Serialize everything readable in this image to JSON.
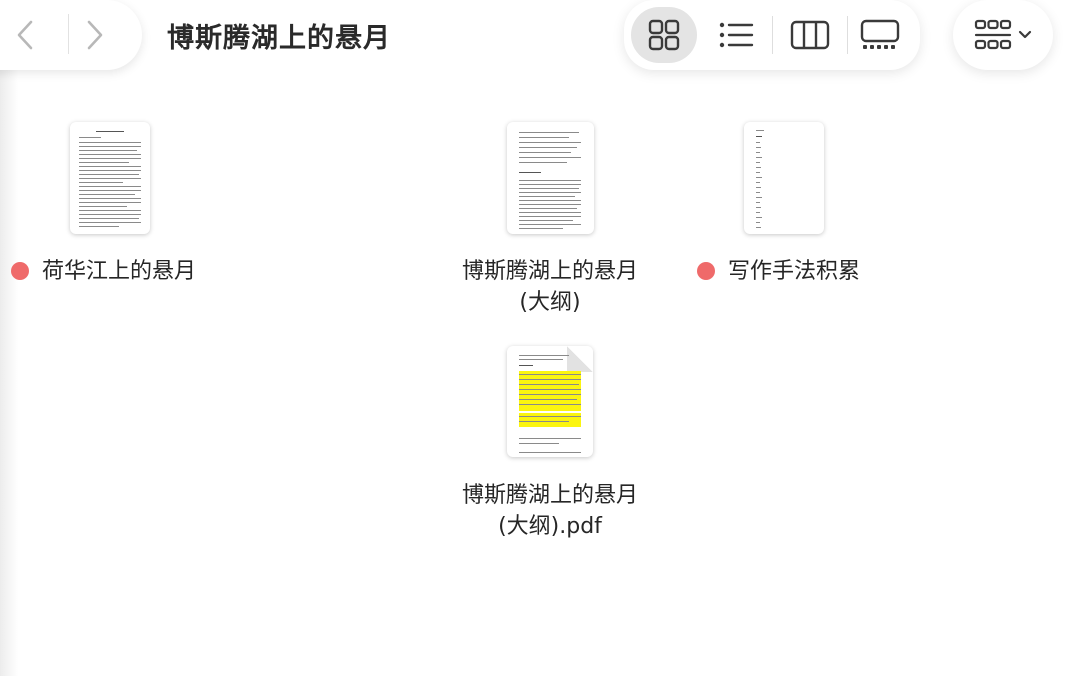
{
  "window": {
    "title": "博斯腾湖上的悬月"
  },
  "toolbar": {
    "back_icon": "chevron-left-icon",
    "forward_icon": "chevron-right-icon",
    "views": [
      {
        "name": "icons",
        "icon": "grid-icon",
        "active": true
      },
      {
        "name": "list",
        "icon": "list-icon",
        "active": false
      },
      {
        "name": "columns",
        "icon": "columns-icon",
        "active": false
      },
      {
        "name": "gallery",
        "icon": "gallery-icon",
        "active": false
      }
    ],
    "group_icon": "group-by-icon",
    "group_chevron": "chevron-down-icon"
  },
  "colors": {
    "tag_red": "#ef6a6a",
    "highlight": "#fbf50f",
    "active_view": "#e4e4e4"
  },
  "files": [
    {
      "name": "荷华江上的悬月",
      "tag": "red"
    },
    {
      "name_line1": "博斯腾湖上的悬月",
      "name_line2": "(大纲)",
      "tag": null
    },
    {
      "name": "写作手法积累",
      "tag": "red"
    },
    {
      "name_line1": "博斯腾湖上的悬月",
      "name_line2": "(大纲).pdf",
      "tag": null
    }
  ]
}
